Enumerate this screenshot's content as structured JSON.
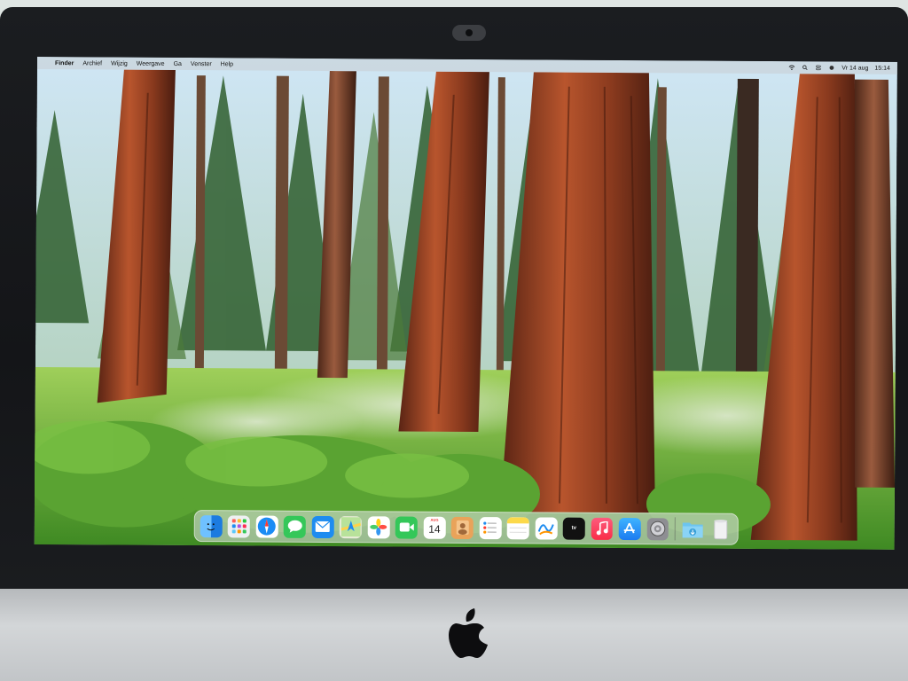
{
  "menubar": {
    "apple_symbol": "",
    "items": [
      "Finder",
      "Archief",
      "Wijzig",
      "Weergave",
      "Ga",
      "Venster",
      "Help"
    ],
    "date": "Vr 14 aug",
    "time": "15:14",
    "status_icons": [
      "wifi-icon",
      "search-icon",
      "control-center-icon",
      "siri-icon"
    ]
  },
  "dock": {
    "apps": [
      {
        "name": "Finder",
        "icon": "finder-icon",
        "color": "#2f8df0"
      },
      {
        "name": "Launchpad",
        "icon": "launchpad-icon",
        "color": "#eef0f2"
      },
      {
        "name": "Safari",
        "icon": "safari-icon",
        "color": "#ffffff"
      },
      {
        "name": "Berichten",
        "icon": "messages-icon",
        "color": "#35c759"
      },
      {
        "name": "Mail",
        "icon": "mail-icon",
        "color": "#1e8cf0"
      },
      {
        "name": "Kaarten",
        "icon": "maps-icon",
        "color": "#f2f2ee"
      },
      {
        "name": "Foto's",
        "icon": "photos-icon",
        "color": "#ffffff"
      },
      {
        "name": "FaceTime",
        "icon": "facetime-icon",
        "color": "#34c759"
      },
      {
        "name": "Agenda",
        "icon": "calendar-icon",
        "color": "#ffffff"
      },
      {
        "name": "Contacten",
        "icon": "contacts-icon",
        "color": "#e9a35a"
      },
      {
        "name": "Herinneringen",
        "icon": "reminders-icon",
        "color": "#ffffff"
      },
      {
        "name": "Notities",
        "icon": "notes-icon",
        "color": "#fcd94a"
      },
      {
        "name": "Freeform",
        "icon": "freeform-icon",
        "color": "#ffffff"
      },
      {
        "name": "Apple TV",
        "icon": "appletv-icon",
        "color": "#111111"
      },
      {
        "name": "Muziek",
        "icon": "music-icon",
        "color": "#fa2d48"
      },
      {
        "name": "App Store",
        "icon": "appstore-icon",
        "color": "#1c8ef5"
      },
      {
        "name": "Systeeminstellingen",
        "icon": "settings-icon",
        "color": "#8e8e93"
      }
    ],
    "calendar_month": "AUG",
    "calendar_day": "14",
    "tv_label": "tv",
    "right": [
      {
        "name": "Downloads",
        "icon": "downloads-folder-icon",
        "color": "#6cc4f0"
      },
      {
        "name": "Prullenmand",
        "icon": "trash-icon",
        "color": "#e8e8ea"
      }
    ]
  },
  "wallpaper": "sequoia-forest"
}
